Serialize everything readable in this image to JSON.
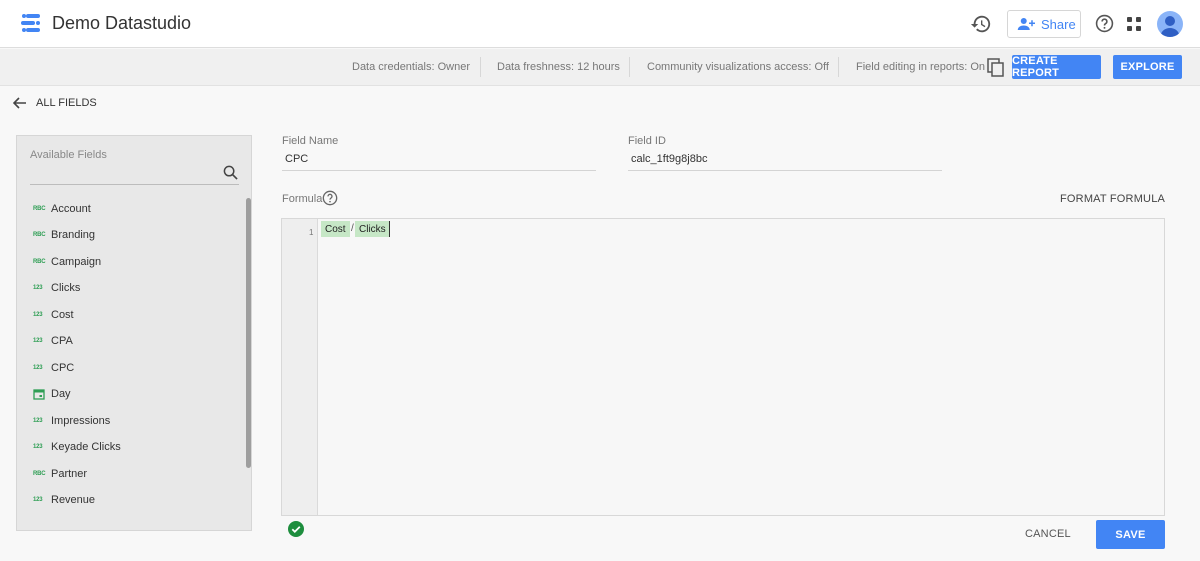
{
  "app": {
    "title": "Demo Datastudio"
  },
  "header": {
    "share_label": "Share"
  },
  "infobar": {
    "credentials": "Data credentials: Owner",
    "freshness": "Data freshness: 12 hours",
    "community_viz": "Community visualizations access: Off",
    "field_editing": "Field editing in reports: On",
    "create_report": "CREATE REPORT",
    "explore": "EXPLORE"
  },
  "nav": {
    "back_label": "ALL FIELDS"
  },
  "fields_panel": {
    "label": "Available Fields",
    "items": [
      {
        "type": "text",
        "type_icon": "ABC",
        "name": "Account"
      },
      {
        "type": "text",
        "type_icon": "ABC",
        "name": "Branding"
      },
      {
        "type": "text",
        "type_icon": "ABC",
        "name": "Campaign"
      },
      {
        "type": "number",
        "type_icon": "123",
        "name": "Clicks"
      },
      {
        "type": "number",
        "type_icon": "123",
        "name": "Cost"
      },
      {
        "type": "number",
        "type_icon": "123",
        "name": "CPA"
      },
      {
        "type": "number",
        "type_icon": "123",
        "name": "CPC"
      },
      {
        "type": "date",
        "type_icon": "calendar-icon",
        "name": "Day"
      },
      {
        "type": "number",
        "type_icon": "123",
        "name": "Impressions"
      },
      {
        "type": "number",
        "type_icon": "123",
        "name": "Keyade Clicks"
      },
      {
        "type": "text",
        "type_icon": "ABC",
        "name": "Partner"
      },
      {
        "type": "number",
        "type_icon": "123",
        "name": "Revenue"
      }
    ]
  },
  "editor": {
    "field_name_label": "Field Name",
    "field_name_value": "CPC",
    "field_id_label": "Field ID",
    "field_id_value": "calc_1ft9g8j8bc",
    "formula_label": "Formula",
    "format_label": "FORMAT FORMULA",
    "line_number": "1",
    "formula_tokens": {
      "left": "Cost",
      "operator": "/",
      "right": "Clicks"
    },
    "cancel_label": "CANCEL",
    "save_label": "SAVE"
  },
  "colors": {
    "accent": "#4285f4",
    "token_bg": "#c6e7c6",
    "type_green": "#2e9e54",
    "valid_green": "#1e8e3e"
  }
}
